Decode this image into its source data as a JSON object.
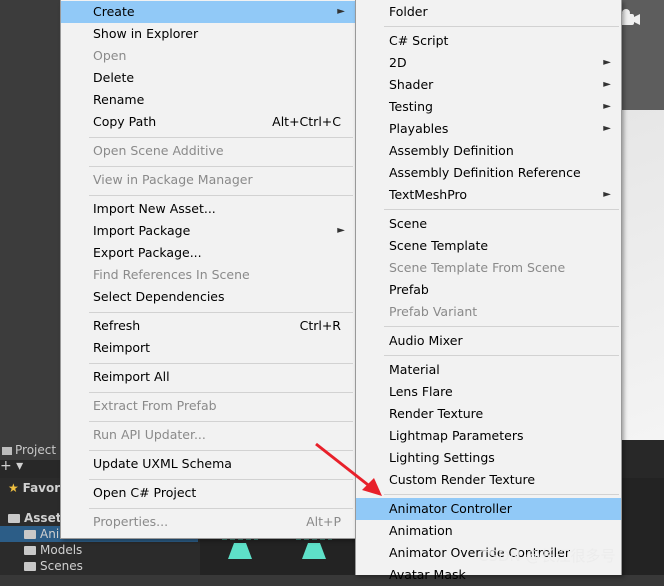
{
  "left_menu": {
    "items": [
      {
        "label": "Create",
        "shortcut": "",
        "submenu": true,
        "disabled": false,
        "highlighted": true
      },
      {
        "label": "Show in Explorer",
        "shortcut": "",
        "submenu": false,
        "disabled": false
      },
      {
        "label": "Open",
        "shortcut": "",
        "submenu": false,
        "disabled": true
      },
      {
        "label": "Delete",
        "shortcut": "",
        "submenu": false,
        "disabled": false
      },
      {
        "label": "Rename",
        "shortcut": "",
        "submenu": false,
        "disabled": false
      },
      {
        "label": "Copy Path",
        "shortcut": "Alt+Ctrl+C",
        "submenu": false,
        "disabled": false
      },
      {
        "label": "Open Scene Additive",
        "shortcut": "",
        "submenu": false,
        "disabled": true
      },
      {
        "label": "View in Package Manager",
        "shortcut": "",
        "submenu": false,
        "disabled": true
      },
      {
        "label": "Import New Asset...",
        "shortcut": "",
        "submenu": false,
        "disabled": false
      },
      {
        "label": "Import Package",
        "shortcut": "",
        "submenu": true,
        "disabled": false
      },
      {
        "label": "Export Package...",
        "shortcut": "",
        "submenu": false,
        "disabled": false
      },
      {
        "label": "Find References In Scene",
        "shortcut": "",
        "submenu": false,
        "disabled": true
      },
      {
        "label": "Select Dependencies",
        "shortcut": "",
        "submenu": false,
        "disabled": false
      },
      {
        "label": "Refresh",
        "shortcut": "Ctrl+R",
        "submenu": false,
        "disabled": false
      },
      {
        "label": "Reimport",
        "shortcut": "",
        "submenu": false,
        "disabled": false
      },
      {
        "label": "Reimport All",
        "shortcut": "",
        "submenu": false,
        "disabled": false
      },
      {
        "label": "Extract From Prefab",
        "shortcut": "",
        "submenu": false,
        "disabled": true
      },
      {
        "label": "Run API Updater...",
        "shortcut": "",
        "submenu": false,
        "disabled": true
      },
      {
        "label": "Update UXML Schema",
        "shortcut": "",
        "submenu": false,
        "disabled": false
      },
      {
        "label": "Open C# Project",
        "shortcut": "",
        "submenu": false,
        "disabled": false
      },
      {
        "label": "Properties...",
        "shortcut": "Alt+P",
        "submenu": false,
        "disabled": true
      }
    ]
  },
  "right_menu": {
    "items": [
      {
        "label": "Folder",
        "submenu": false,
        "disabled": false
      },
      {
        "label": "C# Script",
        "submenu": false,
        "disabled": false
      },
      {
        "label": "2D",
        "submenu": true,
        "disabled": false
      },
      {
        "label": "Shader",
        "submenu": true,
        "disabled": false
      },
      {
        "label": "Testing",
        "submenu": true,
        "disabled": false
      },
      {
        "label": "Playables",
        "submenu": true,
        "disabled": false
      },
      {
        "label": "Assembly Definition",
        "submenu": false,
        "disabled": false
      },
      {
        "label": "Assembly Definition Reference",
        "submenu": false,
        "disabled": false
      },
      {
        "label": "TextMeshPro",
        "submenu": true,
        "disabled": false
      },
      {
        "label": "Scene",
        "submenu": false,
        "disabled": false
      },
      {
        "label": "Scene Template",
        "submenu": false,
        "disabled": false
      },
      {
        "label": "Scene Template From Scene",
        "submenu": false,
        "disabled": true
      },
      {
        "label": "Prefab",
        "submenu": false,
        "disabled": false
      },
      {
        "label": "Prefab Variant",
        "submenu": false,
        "disabled": true
      },
      {
        "label": "Audio Mixer",
        "submenu": false,
        "disabled": false
      },
      {
        "label": "Material",
        "submenu": false,
        "disabled": false
      },
      {
        "label": "Lens Flare",
        "submenu": false,
        "disabled": false
      },
      {
        "label": "Render Texture",
        "submenu": false,
        "disabled": false
      },
      {
        "label": "Lightmap Parameters",
        "submenu": false,
        "disabled": false
      },
      {
        "label": "Lighting Settings",
        "submenu": false,
        "disabled": false
      },
      {
        "label": "Custom Render Texture",
        "submenu": false,
        "disabled": false
      },
      {
        "label": "Animator Controller",
        "submenu": false,
        "disabled": false,
        "highlighted": true
      },
      {
        "label": "Animation",
        "submenu": false,
        "disabled": false
      },
      {
        "label": "Animator Override Controller",
        "submenu": false,
        "disabled": false
      },
      {
        "label": "Avatar Mask",
        "submenu": false,
        "disabled": false
      }
    ]
  },
  "project_panel": {
    "tab_label": "Project",
    "favorites_label": "Favor",
    "assets_label": "Asset",
    "folders": [
      "Animation",
      "Models",
      "Scenes"
    ]
  },
  "watermark": "CSDN @长江很多号",
  "colors": {
    "highlight": "#91c9f7",
    "pointer": "#e8202a",
    "disabled_text": "#8a8a8a"
  }
}
